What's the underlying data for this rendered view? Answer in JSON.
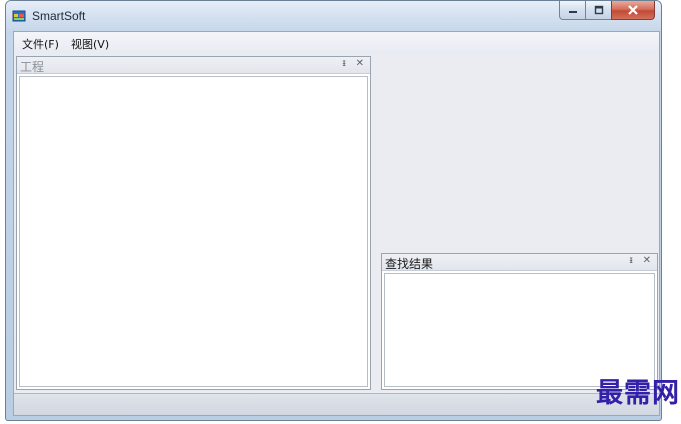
{
  "window": {
    "title": "SmartSoft",
    "app_icon": "app-window-icon",
    "buttons": {
      "minimize": "minimize-icon",
      "maximize": "maximize-icon",
      "close": "close-icon"
    }
  },
  "menu": {
    "items": [
      {
        "label": "文件(F)"
      },
      {
        "label": "视图(V)"
      }
    ]
  },
  "panels": {
    "project": {
      "title": "工程",
      "pin": "ᵻ",
      "close": "✕"
    },
    "search_results": {
      "title": "查找结果",
      "pin": "ᵻ",
      "close": "✕"
    }
  },
  "watermark": "最需网",
  "colors": {
    "client_bg": "#eaecf1",
    "close_button": "#c24a34",
    "watermark": "#3320a8"
  }
}
